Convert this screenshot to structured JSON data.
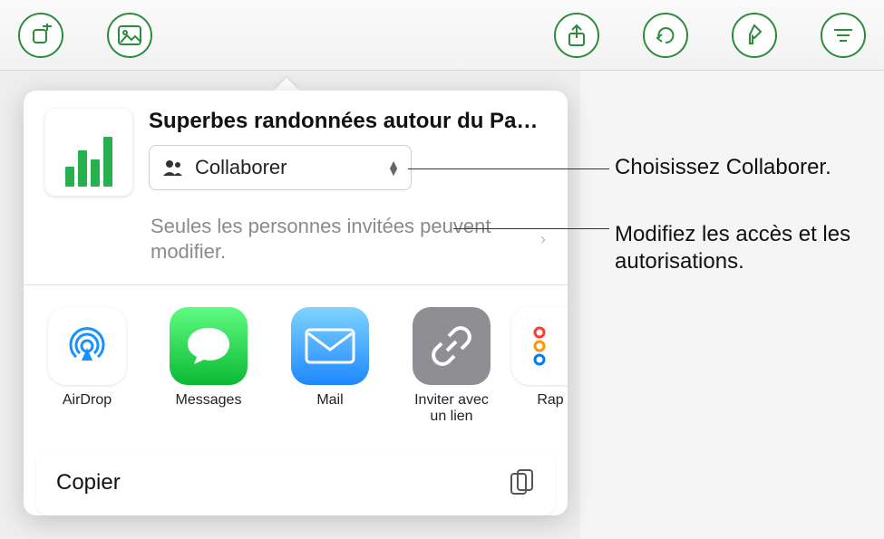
{
  "toolbar": {
    "buttons": [
      "add-shape",
      "insert-media",
      "share",
      "undo",
      "format-brush",
      "more"
    ]
  },
  "sheet": {
    "doc_title": "Superbes randonnées autour du Pa…",
    "collab": {
      "label": "Collaborer"
    },
    "permissions": {
      "text": "Seules les personnes invitées peuvent modifier."
    },
    "apps": {
      "airdrop": "AirDrop",
      "messages": "Messages",
      "mail": "Mail",
      "invite_link": "Inviter avec un lien",
      "rappels": "Rap"
    },
    "copy": {
      "label": "Copier"
    }
  },
  "callouts": {
    "c1": "Choisissez Collaborer.",
    "c2": "Modifiez les accès et les autorisations."
  }
}
